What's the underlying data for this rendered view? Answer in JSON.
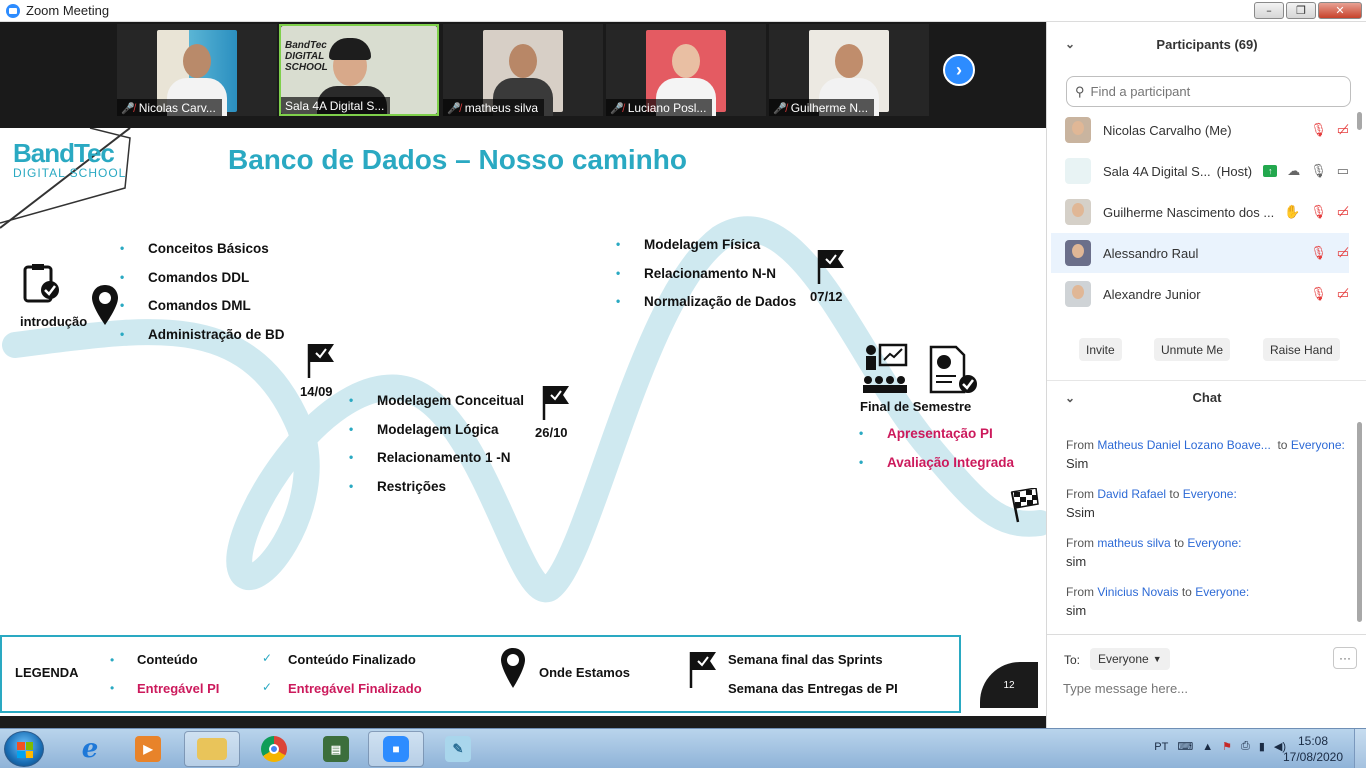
{
  "window": {
    "title": "Zoom Meeting",
    "controls": [
      "–",
      "❐",
      "✕"
    ]
  },
  "video_strip": {
    "tiles": [
      {
        "name": "Nicolas Carv...",
        "muted": true
      },
      {
        "name": "Sala 4A Digital S...",
        "muted": false,
        "tile_text": "BandTec DIGITAL SCHOOL"
      },
      {
        "name": "matheus silva",
        "muted": true
      },
      {
        "name": "Luciano Posl...",
        "muted": true
      },
      {
        "name": "Guilherme N...",
        "muted": true
      }
    ],
    "next_label": "›"
  },
  "slide": {
    "brand_line1": "BandTec",
    "brand_line2": "DIGITAL SCHOOL",
    "title": "Banco de Dados – Nosso caminho",
    "start_label": "introdução",
    "group1": [
      "Conceitos Básicos",
      "Comandos DDL",
      "Comandos DML",
      "Administração de BD"
    ],
    "date1": "14/09",
    "group2": [
      "Modelagem Conceitual",
      "Modelagem Lógica",
      "Relacionamento 1 -N",
      "Restrições"
    ],
    "date2": "26/10",
    "group3": [
      "Modelagem Física",
      "Relacionamento N-N",
      "Normalização de Dados"
    ],
    "date3": "07/12",
    "final_label": "Final de Semestre",
    "group4": [
      "Apresentação PI",
      "Avaliação Integrada"
    ],
    "page_number": "12",
    "legend": {
      "title": "LEGENDA",
      "content": "Conteúdo",
      "deliverable": "Entregável PI",
      "content_done": "Conteúdo Finalizado",
      "deliverable_done": "Entregável Finalizado",
      "where_we_are": "Onde Estamos",
      "sprint_week": "Semana final das Sprints",
      "pi_week": "Semana das Entregas de PI"
    },
    "colors": {
      "accent": "#2aa9c2",
      "pink": "#cc1a5c",
      "road": "#cfe9f0"
    }
  },
  "participants": {
    "header": "Participants (69)",
    "search_placeholder": "Find a participant",
    "list": [
      {
        "name": "Nicolas Carvalho (Me)",
        "tag": ""
      },
      {
        "name": "Sala 4A Digital S...",
        "tag": "(Host)"
      },
      {
        "name": "Guilherme Nascimento dos ...",
        "tag": ""
      },
      {
        "name": "Alessandro Raul",
        "tag": ""
      },
      {
        "name": "Alexandre Junior",
        "tag": ""
      }
    ],
    "actions": {
      "invite": "Invite",
      "unmute": "Unmute Me",
      "raise_hand": "Raise Hand"
    }
  },
  "chat": {
    "header": "Chat",
    "messages": [
      {
        "from_prefix": "From",
        "sender": "Matheus Daniel Lozano Boave...",
        "to_prefix": "to",
        "recipient": "Everyone:",
        "text": "Sim"
      },
      {
        "from_prefix": "From",
        "sender": "David Rafael",
        "to_prefix": "to",
        "recipient": "Everyone:",
        "text": "Ssim"
      },
      {
        "from_prefix": "From",
        "sender": "matheus silva",
        "to_prefix": "to",
        "recipient": "Everyone:",
        "text": "sim"
      },
      {
        "from_prefix": "From",
        "sender": "Vinicius Novais",
        "to_prefix": "to",
        "recipient": "Everyone:",
        "text": "sim"
      }
    ],
    "to_label": "To:",
    "to_value": "Everyone",
    "more": "···",
    "input_placeholder": "Type message here..."
  },
  "taskbar": {
    "language": "PT",
    "time": "15:08",
    "date": "17/08/2020"
  }
}
